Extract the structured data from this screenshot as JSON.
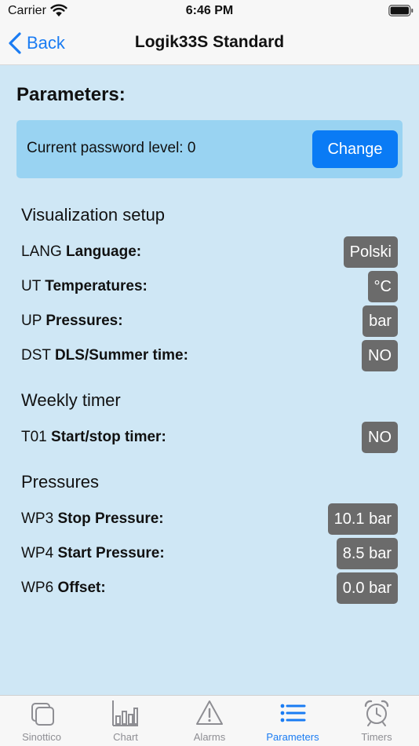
{
  "status": {
    "carrier": "Carrier",
    "time": "6:46 PM"
  },
  "nav": {
    "back_label": "Back",
    "title": "Logik33S Standard"
  },
  "content": {
    "heading": "Parameters:",
    "password_label": "Current password level: 0",
    "change_label": "Change",
    "groups": [
      {
        "title": "Visualization setup",
        "rows": [
          {
            "code": "LANG",
            "name": "Language:",
            "value": "Polski"
          },
          {
            "code": "UT",
            "name": "Temperatures:",
            "value": "°C"
          },
          {
            "code": "UP",
            "name": "Pressures:",
            "value": "bar"
          },
          {
            "code": "DST",
            "name": "DLS/Summer time:",
            "value": "NO"
          }
        ]
      },
      {
        "title": "Weekly timer",
        "rows": [
          {
            "code": "T01",
            "name": "Start/stop timer:",
            "value": "NO"
          }
        ]
      },
      {
        "title": "Pressures",
        "rows": [
          {
            "code": "WP3",
            "name": "Stop Pressure:",
            "value": "10.1 bar"
          },
          {
            "code": "WP4",
            "name": "Start Pressure:",
            "value": "8.5 bar"
          },
          {
            "code": "WP6",
            "name": "Offset:",
            "value": "0.0 bar"
          }
        ]
      }
    ]
  },
  "tabs": [
    {
      "label": "Sinottico",
      "icon": "sinottico-icon",
      "active": false
    },
    {
      "label": "Chart",
      "icon": "chart-icon",
      "active": false
    },
    {
      "label": "Alarms",
      "icon": "alarm-icon",
      "active": false
    },
    {
      "label": "Parameters",
      "icon": "list-icon",
      "active": true
    },
    {
      "label": "Timers",
      "icon": "alarm-clock-icon",
      "active": false
    }
  ],
  "colors": {
    "accent": "#1a7cf3",
    "content_bg": "#cfe7f5",
    "password_bg": "#99d3f2",
    "value_bg": "#6b6b6b",
    "inactive_tab": "#8e8e93"
  }
}
